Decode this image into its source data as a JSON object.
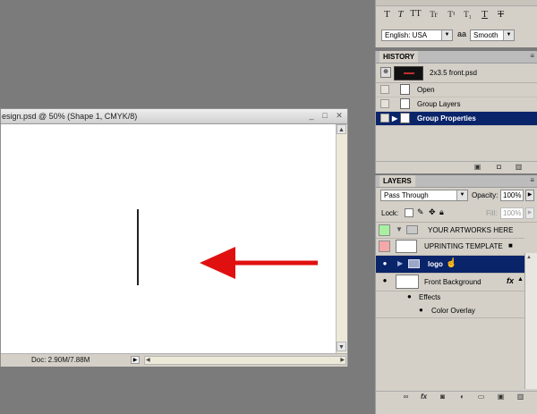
{
  "character_panel": {
    "style_buttons": [
      "T",
      "T",
      "TT",
      "Tr",
      "T¹",
      "T₁",
      "T",
      "Ŧ"
    ],
    "language": "English: USA",
    "aa_label": "aa",
    "antialias": "Smooth"
  },
  "history": {
    "tab": "HISTORY",
    "snapshot_label": "2x3.5 front.psd",
    "items": [
      {
        "label": "Open"
      },
      {
        "label": "Group Layers"
      },
      {
        "label": "Group Properties"
      }
    ]
  },
  "layers": {
    "tab": "LAYERS",
    "blend_mode": "Pass Through",
    "opacity_label": "Opacity:",
    "opacity": "100%",
    "lock_label": "Lock:",
    "fill_label": "Fill:",
    "fill": "100%",
    "rows": [
      {
        "label": "YOUR ARTWORKS HERE"
      },
      {
        "label": "UPRINTING TEMPLATE"
      },
      {
        "label": "logo"
      },
      {
        "label": "Front Background"
      },
      {
        "label": "Effects"
      },
      {
        "label": "Color Overlay"
      }
    ],
    "fx_label": "fx"
  },
  "document": {
    "title": "esign.psd @ 50% (Shape 1, CMYK/8)",
    "status": "Doc: 2.90M/7.88M"
  },
  "colors": {
    "selection": "#0a246a",
    "visibility_green": "#a8f0a0",
    "visibility_red": "#f4a8a8",
    "arrow_red": "#e01010"
  }
}
